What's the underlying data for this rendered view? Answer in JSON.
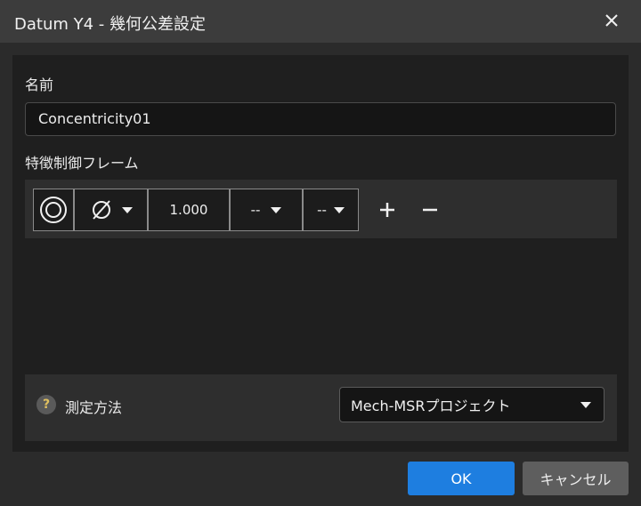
{
  "window": {
    "title": "Datum Y4 - 幾何公差設定"
  },
  "name_section": {
    "label": "名前",
    "value": "Concentricity01"
  },
  "frame_section": {
    "label": "特徴制御フレーム",
    "symbol_icon": "concentricity-icon",
    "diameter_icon": "diameter-icon",
    "tolerance_value": "1.000",
    "datum_primary": "--",
    "datum_secondary": "--",
    "add_icon": "plus-icon",
    "remove_icon": "minus-icon"
  },
  "method_section": {
    "label": "測定方法",
    "help_glyph": "?",
    "selected": "Mech-MSRプロジェクト"
  },
  "buttons": {
    "ok": "OK",
    "cancel": "キャンセル"
  },
  "colors": {
    "primary": "#1e7ee0",
    "secondary": "#5e5e5e",
    "panel": "#1f1f1f",
    "titlebar": "#3c3c3c"
  }
}
